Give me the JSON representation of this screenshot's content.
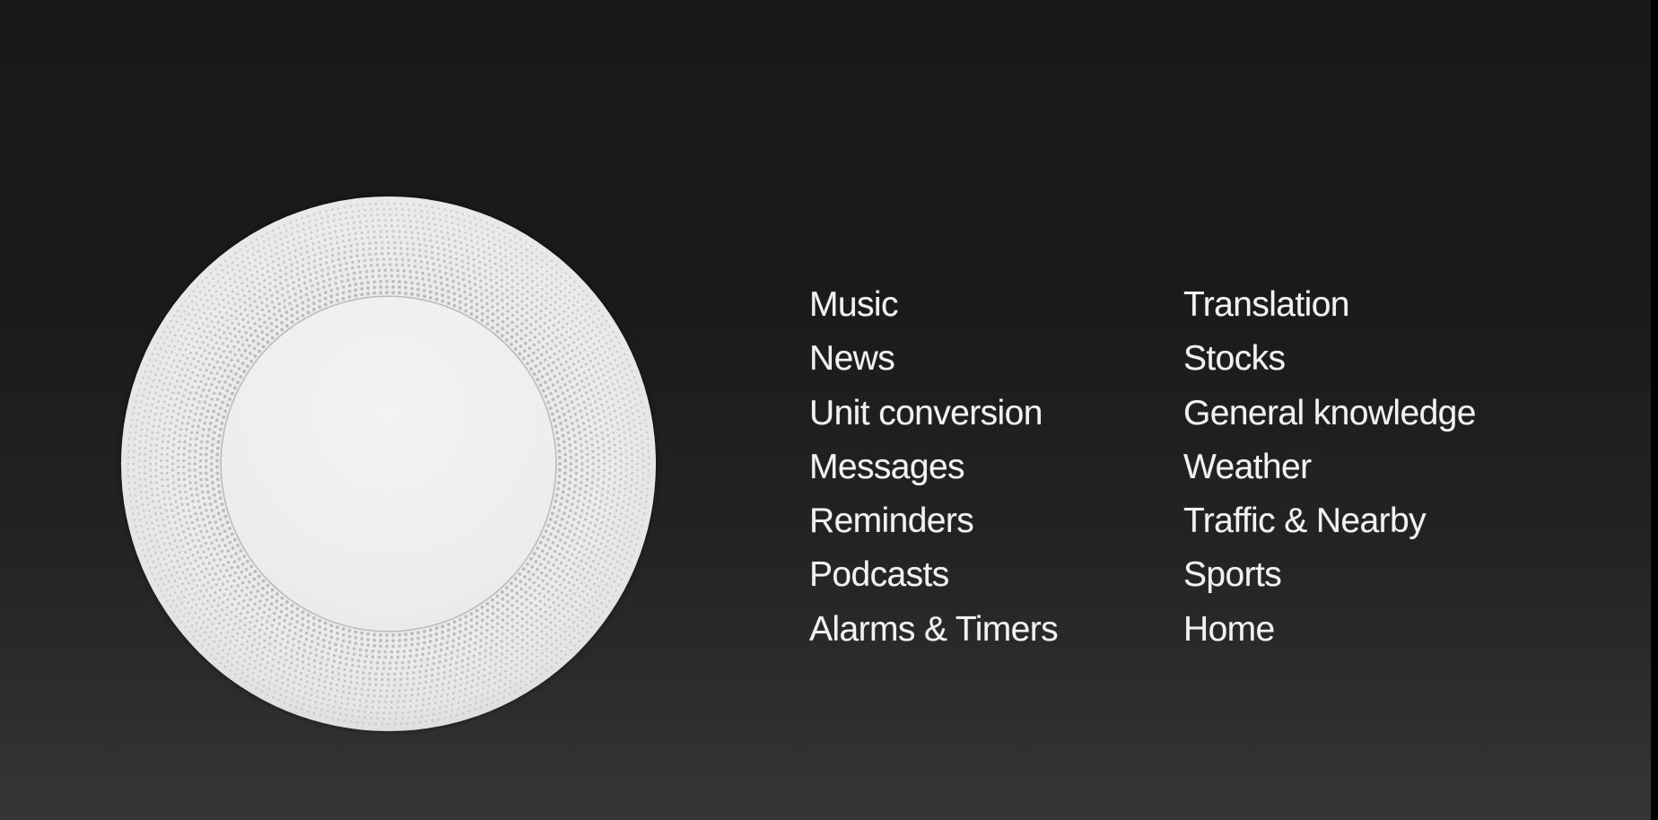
{
  "slide": {
    "subject": "HomePod smart speaker (top view)",
    "colors": {
      "background_top": "#181818",
      "background_bottom": "#353636",
      "text": "#f2f2f2",
      "speaker_mesh": "#ebebeb",
      "speaker_mesh_dot": "#a9a9a9",
      "touch_surface": "#eeeeee"
    }
  },
  "features": {
    "left_column": [
      "Music",
      "News",
      "Unit conversion",
      "Messages",
      "Reminders",
      "Podcasts",
      "Alarms & Timers"
    ],
    "right_column": [
      "Translation",
      "Stocks",
      "General knowledge",
      "Weather",
      "Traffic & Nearby",
      "Sports",
      "Home"
    ]
  }
}
